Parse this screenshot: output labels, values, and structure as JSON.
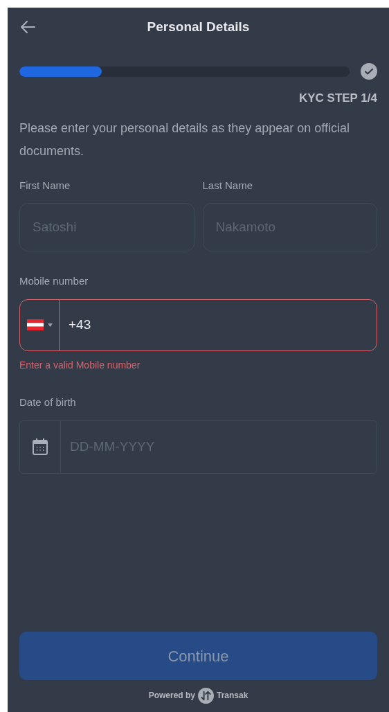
{
  "header": {
    "title": "Personal Details"
  },
  "progress": {
    "level": 0.25,
    "step_label": "KYC STEP 1/4"
  },
  "intro": "Please enter your personal details as they appear on official documents.",
  "name_fields": [
    {
      "label": "First Name",
      "placeholder": "Satoshi"
    },
    {
      "label": "Last Name",
      "placeholder": "Nakamoto"
    }
  ],
  "mobile": {
    "label": "Mobile number",
    "value": "+43",
    "invalid": true,
    "error": "Enter a valid Mobile number"
  },
  "birth_date": {
    "label": "Date of birth",
    "placeholder": "DD-MM-YYYY"
  },
  "continue_button": {
    "label": "Continue",
    "disabled": true
  },
  "footer": {
    "prefix": "Powered by",
    "brand": "Transak"
  }
}
